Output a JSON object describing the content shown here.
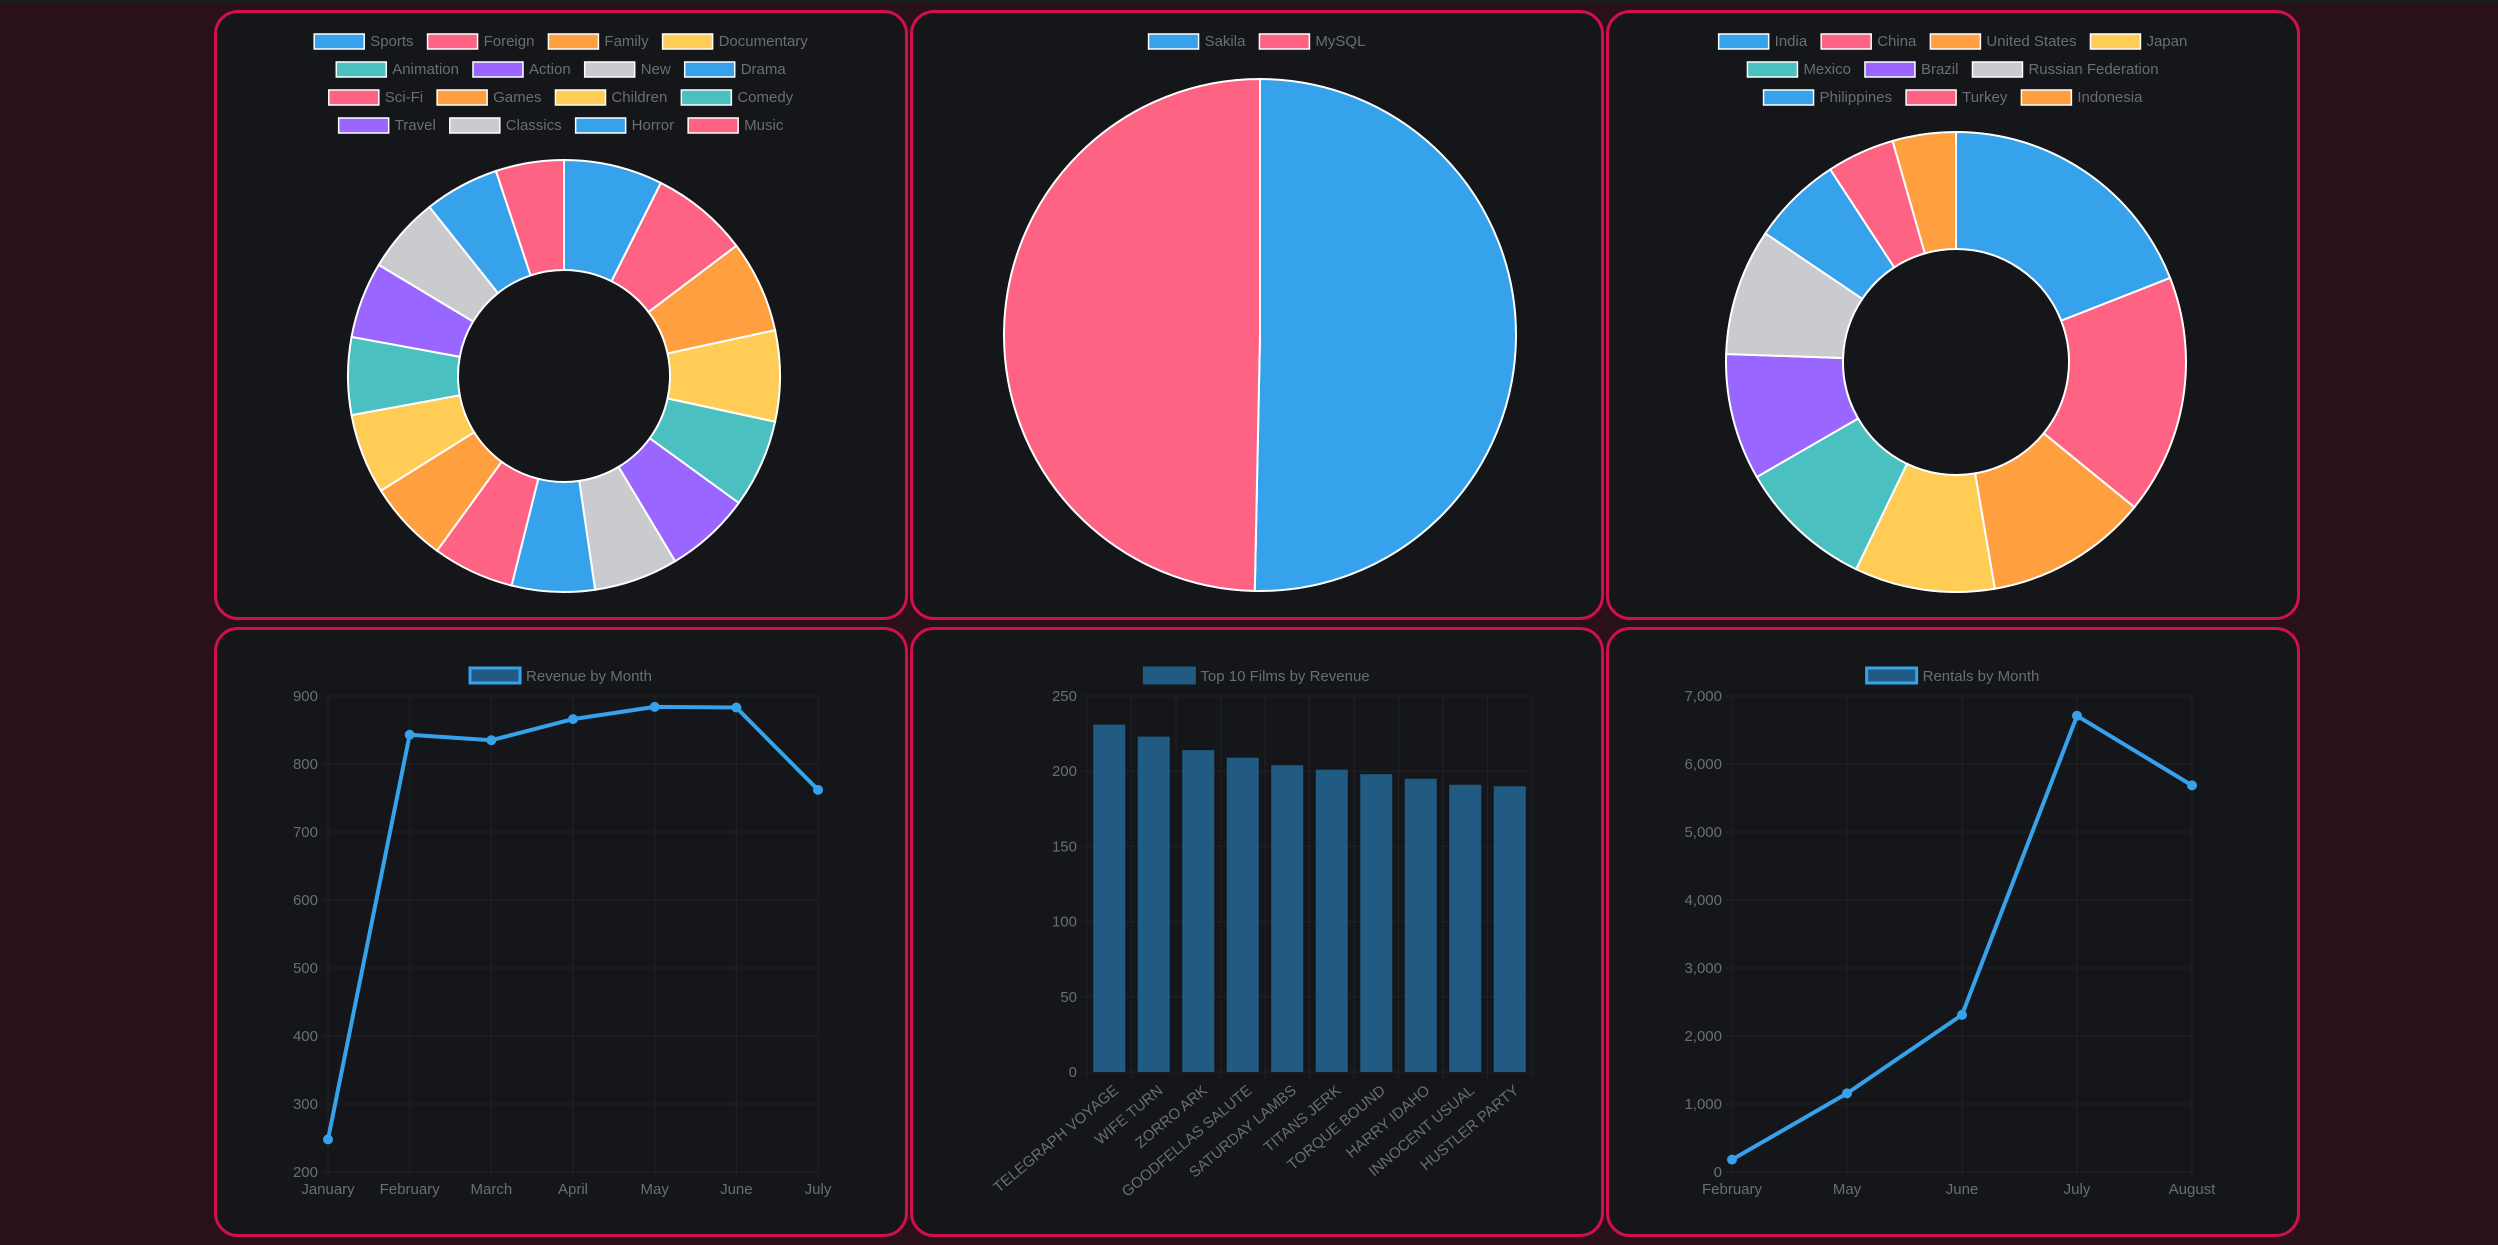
{
  "colors": {
    "background": "#2a1119",
    "panel_bg": "#141619",
    "panel_border": "#d0104c",
    "palette": [
      "#36a2eb",
      "#ff6384",
      "#ff9f40",
      "#ffcd56",
      "#4bc0c0",
      "#9966ff",
      "#c9cbcf"
    ],
    "line": "#36a2eb",
    "bar_fill": "#215a82",
    "text": "#6a6e72",
    "grid": "#202326"
  },
  "chart_data": [
    {
      "id": "categories",
      "type": "doughnut",
      "labels": [
        "Sports",
        "Foreign",
        "Family",
        "Documentary",
        "Animation",
        "Action",
        "New",
        "Drama",
        "Sci-Fi",
        "Games",
        "Children",
        "Comedy",
        "Travel",
        "Classics",
        "Horror",
        "Music"
      ],
      "values": [
        74,
        73,
        69,
        68,
        66,
        64,
        63,
        62,
        61,
        61,
        60,
        58,
        57,
        57,
        56,
        51
      ],
      "legend": "top"
    },
    {
      "id": "stores",
      "type": "pie",
      "labels": [
        "Sakila",
        "MySQL"
      ],
      "values": [
        33927,
        33490
      ],
      "legend": "top"
    },
    {
      "id": "countries",
      "type": "doughnut",
      "labels": [
        "India",
        "China",
        "United States",
        "Japan",
        "Mexico",
        "Brazil",
        "Russian Federation",
        "Philippines",
        "Turkey",
        "Indonesia"
      ],
      "values": [
        60,
        53,
        36,
        31,
        30,
        28,
        28,
        20,
        15,
        14
      ],
      "legend": "top"
    },
    {
      "id": "revenue",
      "type": "line",
      "title": "Revenue by Month",
      "x": [
        "January",
        "February",
        "March",
        "April",
        "May",
        "June",
        "July"
      ],
      "y": [
        248,
        843,
        835,
        866,
        884,
        883,
        762
      ],
      "ylim": [
        200,
        900
      ],
      "yticks": [
        200,
        300,
        400,
        500,
        600,
        700,
        800,
        900
      ],
      "grid": true
    },
    {
      "id": "top-films",
      "type": "bar",
      "title": "Top 10 Films by Revenue",
      "categories": [
        "TELEGRAPH VOYAGE",
        "WIFE TURN",
        "ZORRO ARK",
        "GOODFELLAS SALUTE",
        "SATURDAY LAMBS",
        "TITANS JERK",
        "TORQUE BOUND",
        "HARRY IDAHO",
        "INNOCENT USUAL",
        "HUSTLER PARTY"
      ],
      "values": [
        231,
        223,
        214,
        209,
        204,
        201,
        198,
        195,
        191,
        190
      ],
      "ylim": [
        0,
        250
      ],
      "yticks": [
        0,
        50,
        100,
        150,
        200,
        250
      ],
      "grid": true
    },
    {
      "id": "rentals",
      "type": "line",
      "title": "Rentals by Month",
      "x": [
        "February",
        "May",
        "June",
        "July",
        "August"
      ],
      "y": [
        182,
        1156,
        2311,
        6709,
        5686
      ],
      "ylim": [
        0,
        7000
      ],
      "yticks": [
        0,
        1000,
        2000,
        3000,
        4000,
        5000,
        6000,
        7000
      ],
      "ytick_labels": [
        "0",
        "1,000",
        "2,000",
        "3,000",
        "4,000",
        "5,000",
        "6,000",
        "7,000"
      ],
      "grid": true
    }
  ]
}
